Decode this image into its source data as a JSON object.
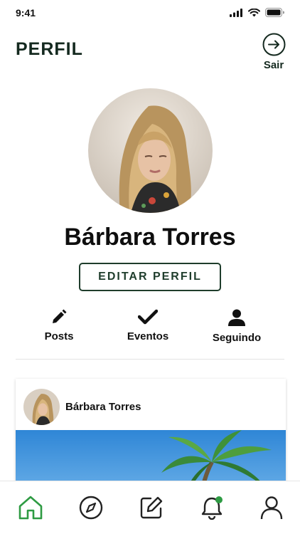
{
  "status_bar": {
    "time": "9:41"
  },
  "header": {
    "title": "PERFIL",
    "logout_label": "Sair"
  },
  "profile": {
    "name": "Bárbara Torres",
    "edit_button_label": "EDITAR PERFIL"
  },
  "stats": [
    {
      "label": "Posts",
      "icon": "pencil-icon"
    },
    {
      "label": "Eventos",
      "icon": "check-icon"
    },
    {
      "label": "Seguindo",
      "icon": "person-icon"
    }
  ],
  "post": {
    "author": "Bárbara Torres"
  },
  "tab_bar": {
    "items": [
      {
        "icon": "home-icon",
        "active": true
      },
      {
        "icon": "compass-icon",
        "active": false
      },
      {
        "icon": "edit-icon",
        "active": false
      },
      {
        "icon": "bell-icon",
        "active": false,
        "badge": true
      },
      {
        "icon": "user-icon",
        "active": false
      }
    ]
  },
  "colors": {
    "brand": "#1f3d2c",
    "active_tab": "#2e9b43",
    "badge": "#2e9b43"
  }
}
